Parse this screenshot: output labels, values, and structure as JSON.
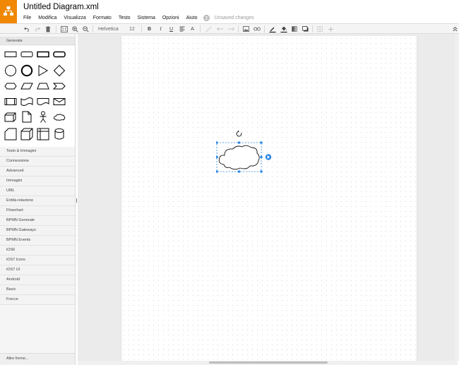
{
  "header": {
    "title": "Untitled Diagram.xml",
    "menu": [
      "File",
      "Modifica",
      "Visualizza",
      "Formato",
      "Testo",
      "Sistema",
      "Opzioni",
      "Aiuto"
    ],
    "status": "Unsaved changes"
  },
  "toolbar": {
    "font_family": "Helvetica",
    "font_size": "12",
    "bold": "B",
    "italic": "I",
    "underline": "U",
    "font_color": "A"
  },
  "sidebar": {
    "general_label": "Generale",
    "sections": [
      "Testo & Immagini",
      "Connessione",
      "Advanced",
      "Immagini",
      "UML",
      "Entità-relazione",
      "Flowchart",
      "BPMN Generale",
      "BPMN Gateways",
      "BPMN Events",
      "iOS6",
      "iOS7 Icons",
      "iOS7 UI",
      "Android",
      "Basic",
      "Frecce"
    ],
    "more_shapes": "Altre forme..."
  },
  "colors": {
    "brand": "#f08705",
    "selection": "#2f8ae5"
  }
}
